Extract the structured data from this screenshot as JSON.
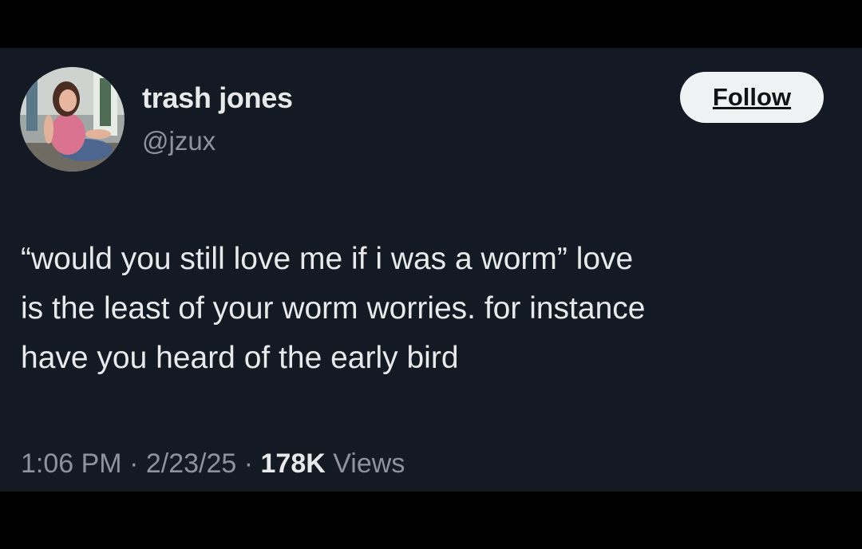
{
  "author": {
    "display_name": "trash jones",
    "handle": "@jzux"
  },
  "follow_button": {
    "label": "Follow"
  },
  "tweet": {
    "lines": [
      "“would you still love me if i was a worm” love",
      "is the least of your worm worries. for instance",
      "have you heard of the early bird"
    ]
  },
  "meta": {
    "time": "1:06 PM",
    "separator": " · ",
    "date": "2/23/25",
    "views_count": "178K",
    "views_label": " Views"
  },
  "colors": {
    "background": "#141a24",
    "primary_text": "#e7e9ea",
    "secondary_text": "#8b949e",
    "button_bg": "#eff3f4"
  }
}
